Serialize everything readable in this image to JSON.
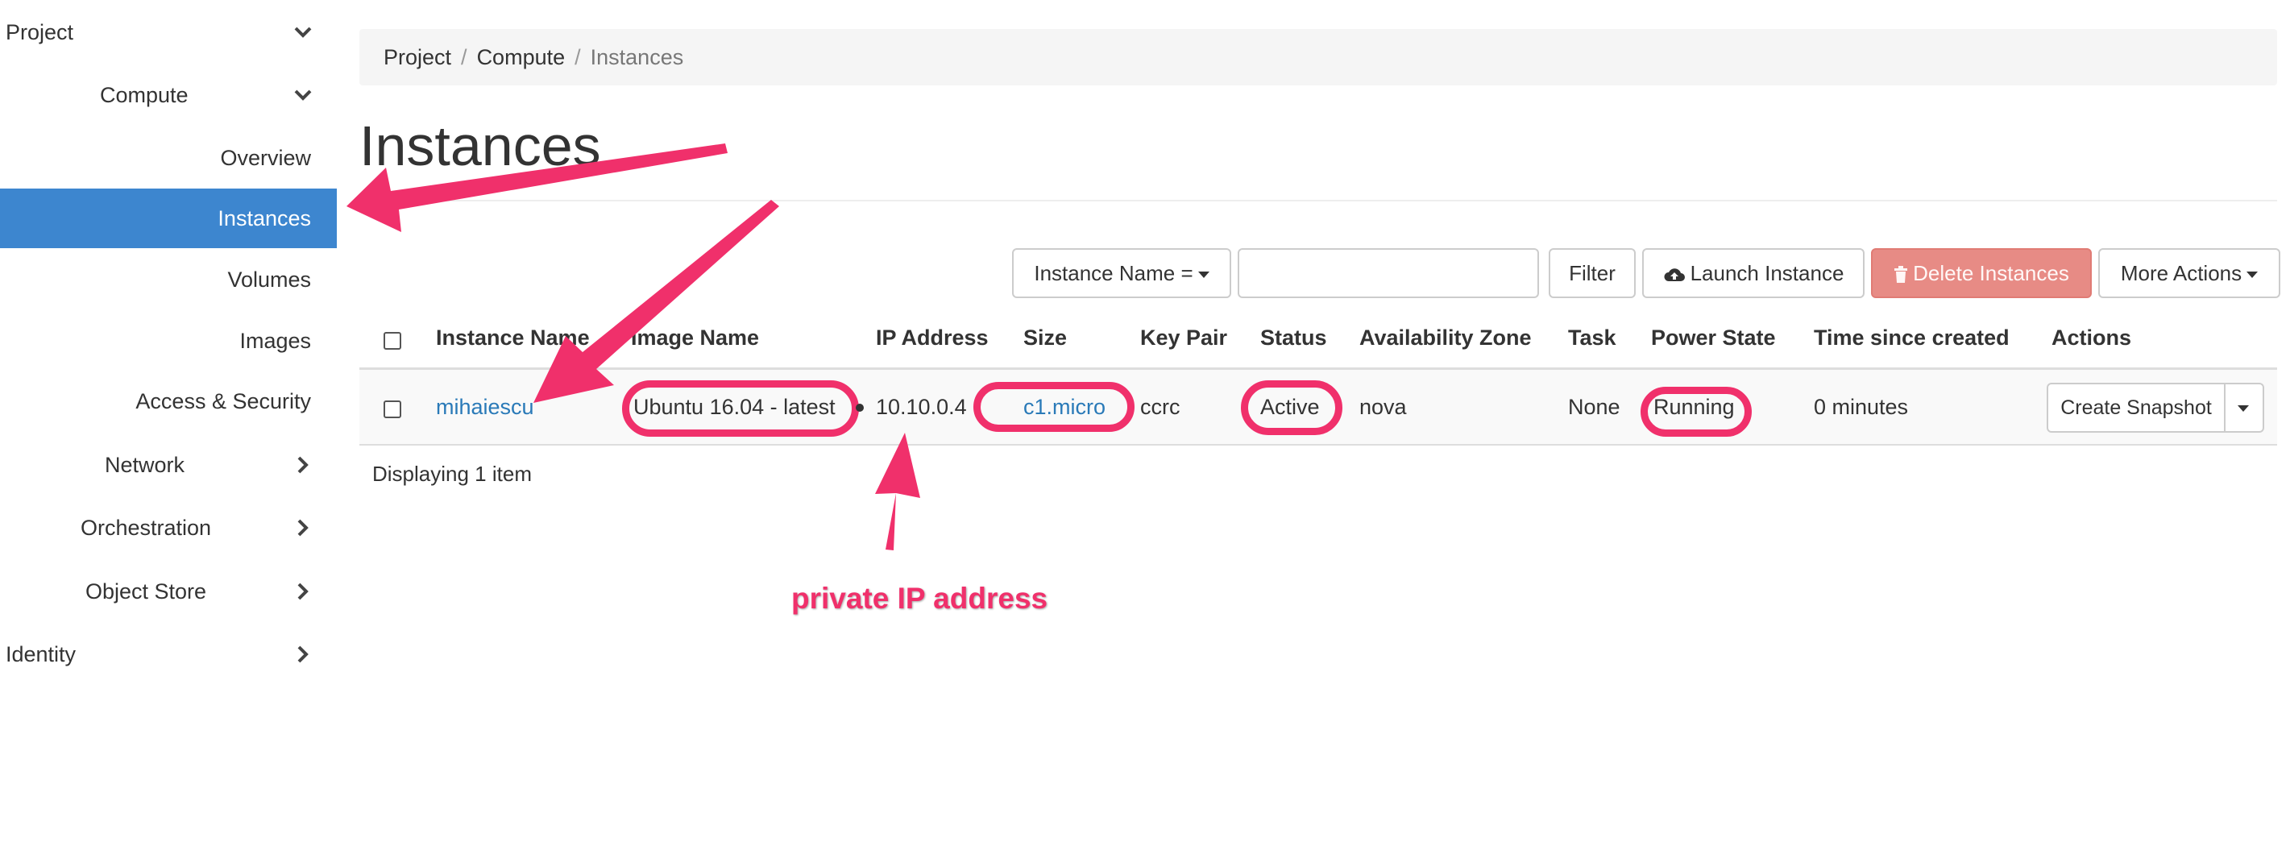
{
  "sidebar": {
    "project": "Project",
    "compute": "Compute",
    "overview": "Overview",
    "instances": "Instances",
    "volumes": "Volumes",
    "images": "Images",
    "access_security": "Access & Security",
    "network": "Network",
    "orchestration": "Orchestration",
    "object_store": "Object Store",
    "identity": "Identity"
  },
  "breadcrumb": {
    "project": "Project",
    "compute": "Compute",
    "current": "Instances",
    "separator": "/"
  },
  "page_title": "Instances",
  "toolbar": {
    "filter_field": "Instance Name =",
    "filter_value": "",
    "filter_button": "Filter",
    "launch_instance": "Launch Instance",
    "delete_instances": "Delete Instances",
    "more_actions": "More Actions"
  },
  "table": {
    "columns": {
      "instance_name": "Instance Name",
      "image_name": "Image Name",
      "ip_address": "IP Address",
      "size": "Size",
      "key_pair": "Key Pair",
      "status": "Status",
      "availability_zone": "Availability Zone",
      "task": "Task",
      "power_state": "Power State",
      "time_since_created": "Time since created",
      "actions": "Actions"
    },
    "row": {
      "instance_name": "mihaiescu",
      "image_name": "Ubuntu 16.04 - latest",
      "ip_address": "10.10.0.4",
      "size": "c1.micro",
      "key_pair": "ccrc",
      "status": "Active",
      "availability_zone": "nova",
      "task": "None",
      "power_state": "Running",
      "time_since_created": "0 minutes",
      "action": "Create Snapshot"
    },
    "footer": "Displaying 1 item"
  },
  "annotation": {
    "label": "private IP address",
    "color": "#f0306b"
  },
  "colors": {
    "active_nav": "#3d86cf",
    "link": "#2a7ab8",
    "danger_button": "#e78b85"
  },
  "icons": {
    "expanded": "chevron-down-icon",
    "collapsed": "chevron-right-icon",
    "launch": "cloud-upload-icon",
    "delete": "trash-icon"
  }
}
